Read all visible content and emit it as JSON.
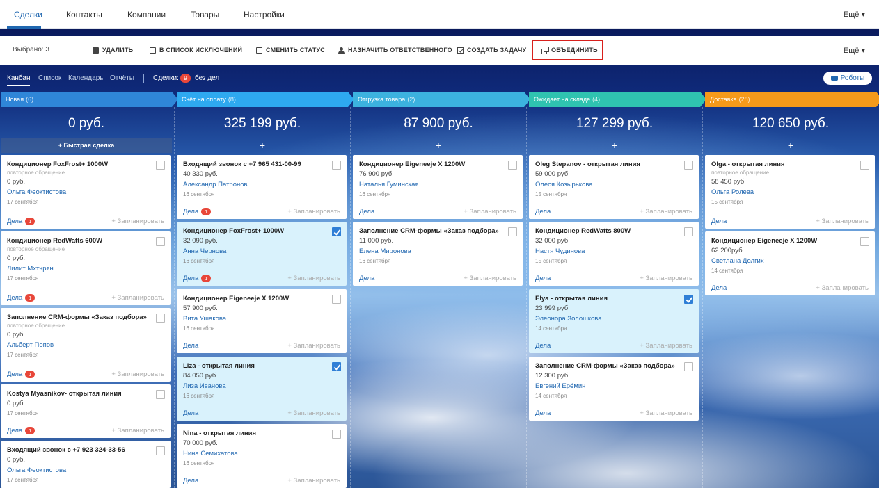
{
  "topnav": {
    "tabs": [
      "Сделки",
      "Контакты",
      "Компании",
      "Товары",
      "Настройки"
    ],
    "more": "Ещё"
  },
  "actionbar": {
    "selected": "Выбрано: 3",
    "delete": "УДАЛИТЬ",
    "exclude": "В СПИСОК ИСКЛЮЧЕНИЙ",
    "status": "СМЕНИТЬ СТАТУС",
    "assign": "НАЗНАЧИТЬ ОТВЕТСТВЕННОГО",
    "task": "СОЗДАТЬ ЗАДАЧУ",
    "merge": "ОБЪЕДИНИТЬ",
    "more": "Ещё"
  },
  "viewbar": {
    "tabs": [
      "Канбан",
      "Список",
      "Календарь",
      "Отчёты"
    ],
    "deals_label": "Сделки:",
    "deals_badge": "9",
    "no_tasks": "без дел",
    "robots": "Роботы"
  },
  "colors": {
    "new": "#2f86d8",
    "payment": "#2ea9f0",
    "shipment": "#3cb2df",
    "warehouse": "#2fc3b0",
    "delivery": "#f59a1a",
    "accent": "#2067b0",
    "badge": "#e8473a"
  },
  "columns": [
    {
      "name": "Новая",
      "count": "(6)",
      "sum": "0 руб.",
      "add": "Быстрая сделка",
      "cards": [
        {
          "title": "Кондиционер FoxFrost+ 1000W",
          "sub": "повторное обращение",
          "price": "0 руб.",
          "person": "Ольга Феоктистова",
          "date": "17 сентября",
          "foot": "Дела",
          "badge": "1",
          "plan": "+ Запланировать"
        },
        {
          "title": "Кондиционер RedWatts 600W",
          "sub": "повторное обращение",
          "price": "0 руб.",
          "person": "Лилит Мхтчрян",
          "date": "17 сентября",
          "foot": "Дела",
          "badge": "1",
          "plan": "+ Запланировать"
        },
        {
          "title": "Заполнение CRM-формы «Заказ подбора»",
          "sub": "повторное обращение",
          "price": "0 руб.",
          "person": "Альберт Попов",
          "date": "17 сентября",
          "foot": "Дела",
          "badge": "1",
          "plan": "+ Запланировать"
        },
        {
          "title": "Kostya Myasnikov- открытая линия",
          "price": "0 руб.",
          "date": "17 сентября",
          "foot": "Дела",
          "badge": "1",
          "plan": "+ Запланировать"
        },
        {
          "title": "Входящий звонок с +7 923 324-33-56",
          "price": "0 руб.",
          "person": "Ольга Феоктистова",
          "date": "17 сентября"
        }
      ]
    },
    {
      "name": "Счёт на оплату",
      "count": "(8)",
      "sum": "325 199 руб.",
      "add": "+",
      "cards": [
        {
          "title": "Входящий звонок с +7 965 431-00-99",
          "price": "40 330 руб.",
          "person": "Александр Патронов",
          "date": "16 сентября",
          "foot": "Дела",
          "badge": "1",
          "plan": "+ Запланировать"
        },
        {
          "title": "Кондиционер FoxFrost+ 1000W",
          "price": "32 090 руб.",
          "person": "Анна Чернова",
          "date": "16 сентября",
          "foot": "Дела",
          "badge": "1",
          "plan": "+ Запланировать",
          "checked": true
        },
        {
          "title": "Кондиционер Eigeneeje X 1200W",
          "price": "57 900 руб.",
          "person": "Вита Ушакова",
          "date": "16 сентября",
          "foot": "Дела",
          "plan": "+ Запланировать"
        },
        {
          "title": "Liza - открытая линия",
          "price": "84 050 руб.",
          "person": "Лиза Иванова",
          "date": "16 сентября",
          "foot": "Дела",
          "plan": "+ Запланировать",
          "checked": true
        },
        {
          "title": "Nina - открытая линия",
          "price": "70 000 руб.",
          "person": "Нина Семихатова",
          "date": "16 сентября",
          "foot": "Дела",
          "plan": "+ Запланировать"
        }
      ]
    },
    {
      "name": "Отгрузка товара",
      "count": "(2)",
      "sum": "87 900 руб.",
      "add": "+",
      "cards": [
        {
          "title": "Кондиционер Eigeneeje X 1200W",
          "price": "76 900 руб.",
          "person": "Наталья Гуминская",
          "date": "16 сентября",
          "foot": "Дела",
          "plan": "+ Запланировать"
        },
        {
          "title": "Заполнение CRM-формы «Заказ подбора»",
          "price": "11 000 руб.",
          "person": "Елена Миронова",
          "date": "16 сентября",
          "foot": "Дела",
          "plan": "+ Запланировать"
        }
      ]
    },
    {
      "name": "Ожидает на складе",
      "count": "(4)",
      "sum": "127 299 руб.",
      "add": "+",
      "cards": [
        {
          "title": "Oleg Stepanov - открытая линия",
          "price": "59 000 руб.",
          "person": "Олеся Козырькова",
          "date": "15 сентября",
          "foot": "Дела",
          "plan": "+ Запланировать"
        },
        {
          "title": "Кондиционер RedWatts 800W",
          "price": "32 000 руб.",
          "person": "Настя Чудинова",
          "date": "15 сентября",
          "foot": "Дела",
          "plan": "+ Запланировать"
        },
        {
          "title": "Elya - открытая линия",
          "price": "23 999 руб.",
          "person": "Элеонора Золошкова",
          "date": "14 сентября",
          "foot": "Дела",
          "plan": "+ Запланировать",
          "checked": true
        },
        {
          "title": "Заполнение CRM-формы «Заказ подбора»",
          "price": "12 300 руб.",
          "person": "Евгений Ерёмин",
          "date": "14 сентября",
          "foot": "Дела",
          "plan": "+ Запланировать"
        }
      ]
    },
    {
      "name": "Доставка",
      "count": "(28)",
      "sum": "120 650 руб.",
      "add": "+",
      "cards": [
        {
          "title": "Olga - открытая линия",
          "sub": "повторное обращение",
          "price": "58 450 руб.",
          "person": "Ольга Ролева",
          "date": "15 сентября",
          "foot": "Дела",
          "plan": "+ Запланировать"
        },
        {
          "title": "Кондиционер Eigeneeje X 1200W",
          "price": "62 200руб.",
          "person": "Светлана Долгих",
          "date": "14 сентября",
          "foot": "Дела",
          "plan": "+ Запланировать"
        }
      ]
    }
  ]
}
